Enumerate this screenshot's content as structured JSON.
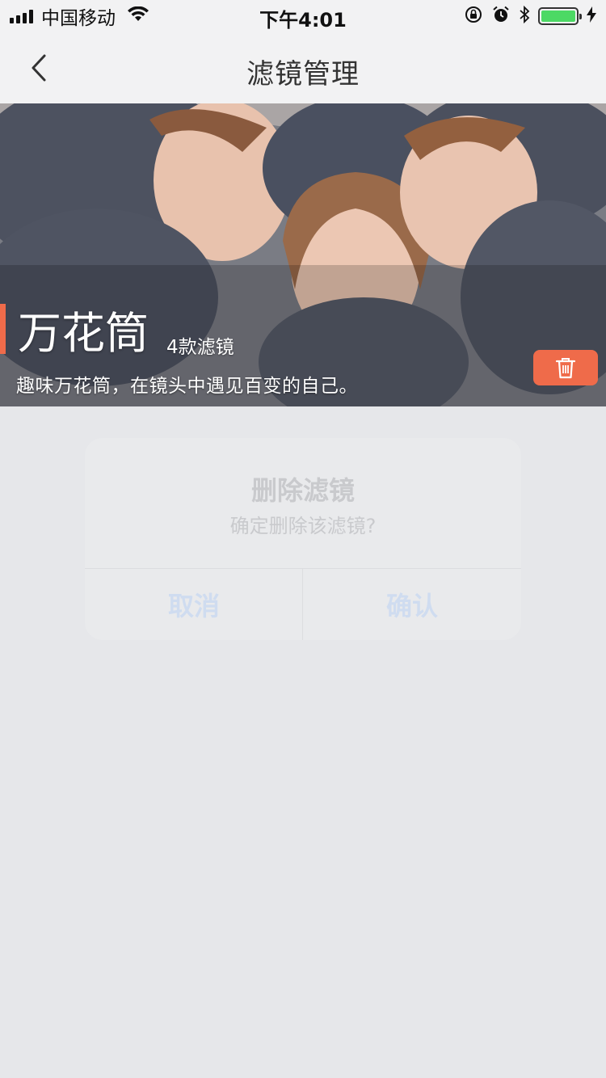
{
  "status_bar": {
    "carrier": "中国移动",
    "time": "下午4:01",
    "battery_level": 1.0,
    "icons": [
      "signal-icon",
      "wifi-icon",
      "rotation-lock-icon",
      "alarm-icon",
      "bluetooth-icon",
      "battery-icon",
      "charging-icon"
    ]
  },
  "nav": {
    "title": "滤镜管理",
    "back_icon": "chevron-left-icon"
  },
  "banner": {
    "title": "万花筒",
    "count": "4款滤镜",
    "description": "趣味万花筒，在镜头中遇见百变的自己。",
    "delete_icon": "trash-icon",
    "accent_color": "#ef6b4a"
  },
  "dialog": {
    "title": "删除滤镜",
    "message": "确定删除该滤镜?",
    "cancel_label": "取消",
    "confirm_label": "确认"
  }
}
